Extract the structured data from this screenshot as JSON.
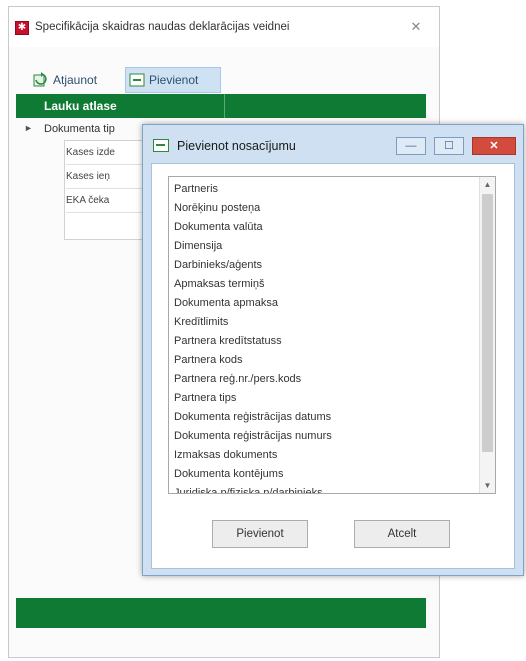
{
  "main_window": {
    "title": "Specifikācija skaidras naudas deklarācijas veidnei",
    "close_glyph": "✕"
  },
  "toolbar": {
    "refresh_label": "Atjaunot",
    "add_label": "Pievienot"
  },
  "grid": {
    "header": "Lauku atlase",
    "group_label": "Dokumenta tip",
    "expander_glyph": "►",
    "subrows": [
      "Kases izde",
      "Kases ieņ",
      "EKA čeka"
    ]
  },
  "dialog": {
    "title": "Pievienot nosacījumu",
    "items": [
      "Partneris",
      "Norēķinu posteņa",
      "Dokumenta valūta",
      "Dimensija",
      "Darbinieks/aģents",
      "Apmaksas termiņš",
      "Dokumenta apmaksa",
      "Kredītlimits",
      "Partnera kredītstatuss",
      "Partnera kods",
      "Partnera reģ.nr./pers.kods",
      "Partnera tips",
      "Dokumenta reģistrācijas datums",
      "Dokumenta reģistrācijas numurs",
      "Izmaksas dokuments",
      "Dokumenta kontējums",
      "Juridiska p/fiziska p/darbinieks"
    ],
    "ok_label": "Pievienot",
    "cancel_label": "Atcelt",
    "scroll_up_glyph": "▲",
    "scroll_down_glyph": "▼",
    "min_glyph": "—",
    "max_glyph": "☐",
    "close_glyph": "✕"
  },
  "colors": {
    "green_accent": "#0f7a33",
    "app_icon_red": "#c8102e",
    "dialog_frame": "#cfe0f3",
    "selected_button": "#cfe2f4"
  }
}
